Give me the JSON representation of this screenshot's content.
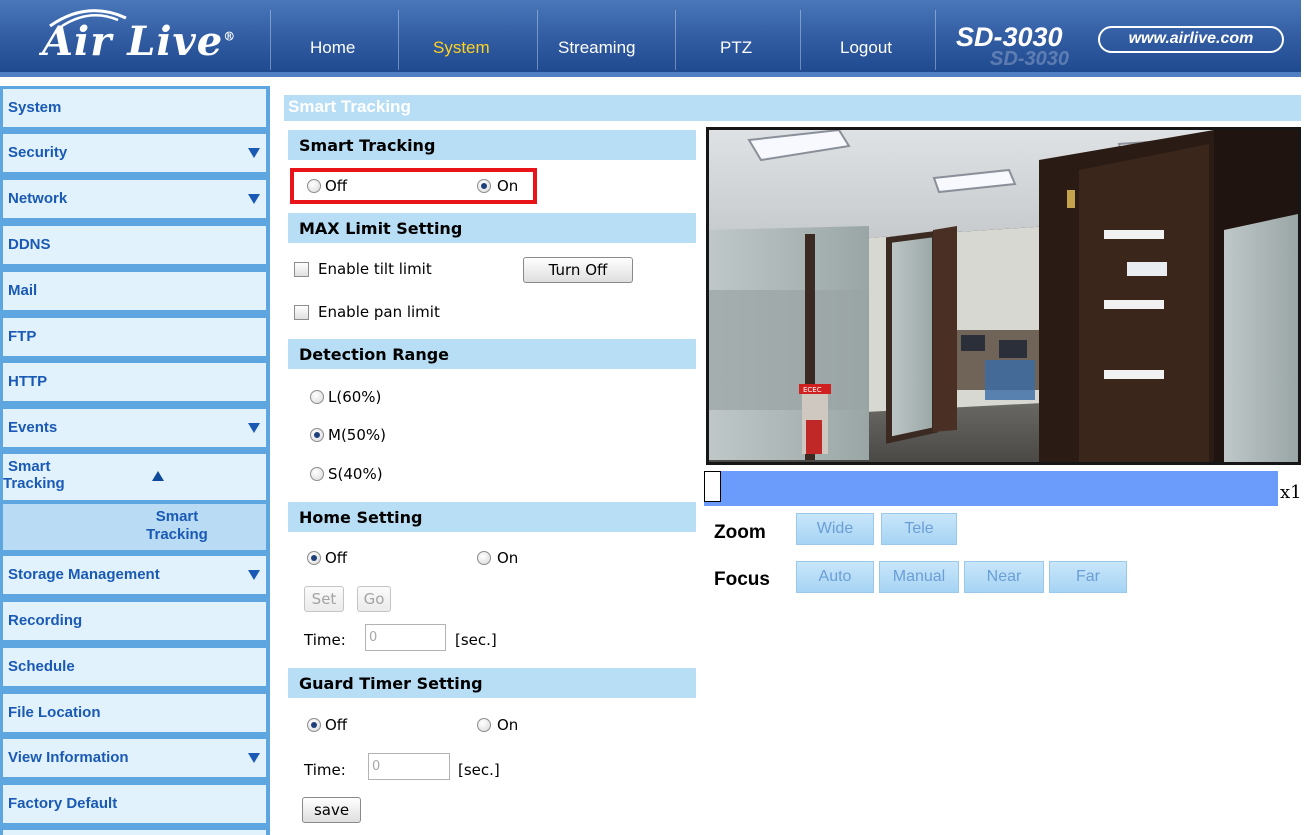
{
  "header": {
    "logo_text": "Air Live",
    "logo_reg": "®",
    "nav": [
      {
        "label": "Home",
        "active": false
      },
      {
        "label": "System",
        "active": true
      },
      {
        "label": "Streaming",
        "active": false
      },
      {
        "label": "PTZ",
        "active": false
      },
      {
        "label": "Logout",
        "active": false
      }
    ],
    "model": "SD-3030",
    "model_shadow": "SD-3030",
    "website": "www.airlive.com"
  },
  "sidebar": {
    "items": [
      {
        "label": "System",
        "arrow": false
      },
      {
        "label": "Security",
        "arrow": true
      },
      {
        "label": "Network",
        "arrow": true
      },
      {
        "label": "DDNS",
        "arrow": false
      },
      {
        "label": "Mail",
        "arrow": false
      },
      {
        "label": "FTP",
        "arrow": false
      },
      {
        "label": "HTTP",
        "arrow": false
      },
      {
        "label": "Events",
        "arrow": true
      },
      {
        "label": "Smart Tracking",
        "line1": "Smart",
        "line2": "Tracking",
        "arrow": "up"
      },
      {
        "label": "Smart Tracking",
        "line1": "Smart",
        "line2": "Tracking",
        "sub": true
      },
      {
        "label": "Storage Management",
        "arrow": true
      },
      {
        "label": "Recording",
        "arrow": false
      },
      {
        "label": "Schedule",
        "arrow": false
      },
      {
        "label": "File Location",
        "arrow": false
      },
      {
        "label": "View Information",
        "arrow": true
      },
      {
        "label": "Factory Default",
        "arrow": false
      }
    ]
  },
  "page_title": "Smart Tracking",
  "smart_tracking": {
    "header": "Smart Tracking",
    "off_label": "Off",
    "on_label": "On",
    "selected": "On"
  },
  "max_limit": {
    "header": "MAX Limit Setting",
    "tilt_label": "Enable tilt limit",
    "tilt_checked": false,
    "pan_label": "Enable pan limit",
    "pan_checked": false,
    "turn_off_button": "Turn Off"
  },
  "detection_range": {
    "header": "Detection Range",
    "options": [
      "L(60%)",
      "M(50%)",
      "S(40%)"
    ],
    "selected": "M(50%)"
  },
  "home_setting": {
    "header": "Home Setting",
    "off_label": "Off",
    "on_label": "On",
    "selected": "Off",
    "set_button": "Set",
    "go_button": "Go",
    "time_label": "Time:",
    "time_value": "0",
    "unit": "[sec.]"
  },
  "guard_timer": {
    "header": "Guard Timer Setting",
    "off_label": "Off",
    "on_label": "On",
    "selected": "Off",
    "time_label": "Time:",
    "time_value": "0",
    "unit": "[sec.]"
  },
  "save_button": "save",
  "camera": {
    "sign_text": "ECEC",
    "zoom_fraction": 0.0,
    "zoom_level": "x1",
    "zoom_label": "Zoom",
    "zoom_buttons": [
      "Wide",
      "Tele"
    ],
    "focus_label": "Focus",
    "focus_buttons": [
      "Auto",
      "Manual",
      "Near",
      "Far"
    ]
  },
  "colors": {
    "header_blue": "#3560a6",
    "nav_active": "#ffd21f",
    "sidebar_blue": "#5ea6e0",
    "section_bg": "#b8def5",
    "highlight_red": "#e8141a",
    "zoom_bar": "#6b9bfb"
  }
}
